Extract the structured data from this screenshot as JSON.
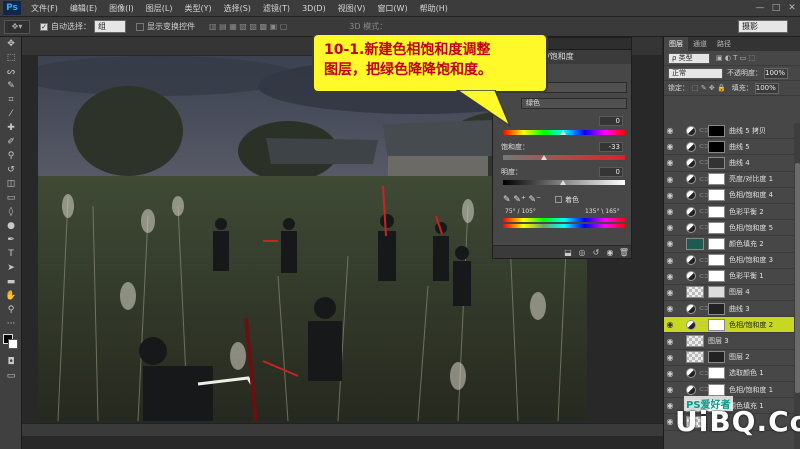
{
  "app": {
    "logo": "Ps",
    "menu": [
      "文件(F)",
      "编辑(E)",
      "图像(I)",
      "图层(L)",
      "类型(Y)",
      "选择(S)",
      "滤镜(T)",
      "3D(D)",
      "视图(V)",
      "窗口(W)",
      "帮助(H)"
    ],
    "window_controls": [
      "—",
      "□",
      "✕"
    ]
  },
  "options_bar": {
    "auto_select_label": "自动选择：",
    "auto_select_value": "组",
    "show_transform_label": "显示变换控件",
    "mode_3d_label": "3D 模式：",
    "workspace_value": "摄影"
  },
  "callout": {
    "line1": "10-1.新建色相饱和度调整",
    "line2": "图层，把绿色降降饱和度。"
  },
  "properties": {
    "tab_label": "色相/饱和度",
    "preset_value": "自定",
    "channel_value": "绿色",
    "hue_value": "0",
    "saturation_label": "饱和度：",
    "saturation_value": "-33",
    "lightness_label": "明度：",
    "lightness_value": "0",
    "colorize_label": "着色",
    "range_left": "75° / 105°",
    "range_right": "135° \\ 165°"
  },
  "layers_panel": {
    "tabs": [
      "图层",
      "通道",
      "路径"
    ],
    "filter_kind": "ρ 类型",
    "blend_mode": "正常",
    "opacity_label": "不透明度：",
    "opacity_value": "100%",
    "lock_label": "锁定：",
    "fill_label": "填充：",
    "fill_value": "100%",
    "layers": [
      {
        "name": "曲线 5 拷贝",
        "kind": "adjustment",
        "mask": "#000000"
      },
      {
        "name": "曲线 5",
        "kind": "adjustment",
        "mask": "#000000"
      },
      {
        "name": "曲线 4",
        "kind": "adjustment",
        "mask": "#333333"
      },
      {
        "name": "亮度/对比度 1",
        "kind": "adjustment",
        "mask": "#ffffff"
      },
      {
        "name": "色相/饱和度 4",
        "kind": "adjustment",
        "mask": "#ffffff"
      },
      {
        "name": "色彩平衡 2",
        "kind": "adjustment",
        "mask": "#ffffff"
      },
      {
        "name": "色相/饱和度 5",
        "kind": "adjustment",
        "mask": "#ffffff"
      },
      {
        "name": "颜色填充 2",
        "kind": "fill",
        "mask": "#ffffff",
        "color": "#1d5a52"
      },
      {
        "name": "色相/饱和度 3",
        "kind": "adjustment",
        "mask": "#ffffff"
      },
      {
        "name": "色彩平衡 1",
        "kind": "adjustment",
        "mask": "#ffffff"
      },
      {
        "name": "图层 4",
        "kind": "pixel",
        "mask": "#dddddd"
      },
      {
        "name": "曲线 3",
        "kind": "adjustment",
        "mask": "#222222"
      },
      {
        "name": "色相/饱和度 2",
        "kind": "adjustment",
        "mask": "#ffffff",
        "selected": true
      },
      {
        "name": "图层 3",
        "kind": "pixel",
        "mask": null
      },
      {
        "name": "图层 2",
        "kind": "pixel",
        "mask": "#222222"
      },
      {
        "name": "选取颜色 1",
        "kind": "adjustment",
        "mask": "#ffffff"
      },
      {
        "name": "色相/饱和度 1",
        "kind": "adjustment",
        "mask": "#ffffff"
      },
      {
        "name": "颜色填充 1",
        "kind": "fill",
        "mask": "#ffffff",
        "color": "#1d5a52"
      },
      {
        "name": "",
        "kind": "pixel",
        "mask": null
      }
    ]
  },
  "watermark": {
    "text": "UiBQ.CoM",
    "small": "PS爱好者"
  }
}
